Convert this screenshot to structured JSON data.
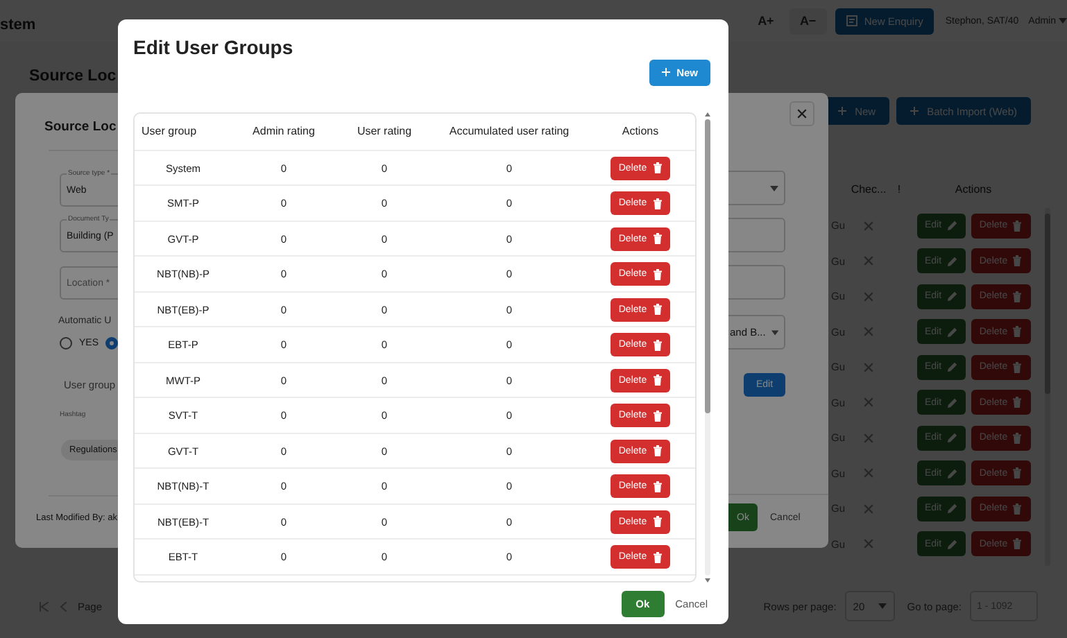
{
  "app_header": {
    "title": "stem",
    "font_increase": "A+",
    "font_decrease": "A−",
    "new_enquiry": "New Enquiry",
    "user": "Stephon, SAT/40",
    "role": "Admin"
  },
  "page": {
    "title": "Source Loc",
    "buttons": [
      "New",
      "Batch Import (Web)"
    ],
    "table": {
      "columns": [
        "Chec...",
        "!",
        "Actions"
      ],
      "rows": [
        {
          "column_1": "Gu",
          "checked": false,
          "edit": "Edit",
          "delete": "Delete"
        },
        {
          "column_1": "Gu",
          "checked": false,
          "edit": "Edit",
          "delete": "Delete"
        },
        {
          "column_1": "Gu",
          "checked": false,
          "edit": "Edit",
          "delete": "Delete"
        },
        {
          "column_1": "Gu",
          "checked": false,
          "edit": "Edit",
          "delete": "Delete"
        },
        {
          "column_1": "Gu",
          "checked": false,
          "edit": "Edit",
          "delete": "Delete"
        },
        {
          "column_1": "Gu",
          "checked": false,
          "edit": "Edit",
          "delete": "Delete"
        },
        {
          "column_1": "Gu",
          "checked": false,
          "edit": "Edit",
          "delete": "Delete"
        },
        {
          "column_1": "Gu",
          "checked": false,
          "edit": "Edit",
          "delete": "Delete"
        },
        {
          "column_1": "Gu",
          "checked": false,
          "edit": "Edit",
          "delete": "Delete"
        },
        {
          "column_1": "Gu",
          "checked": false,
          "edit": "Edit",
          "delete": "Delete"
        }
      ]
    },
    "pagination": {
      "page_label": "Page",
      "rows_per_page_label": "Rows per page:",
      "rows_per_page": "20",
      "go_to_page_label": "Go to page:",
      "go_to_page_placeholder": "1 - 1092"
    }
  },
  "source_dialog": {
    "title": "Source Loc",
    "fields": [
      {
        "label": "Source type *",
        "value": "Web"
      },
      {
        "label": "Document Ty",
        "value": "Building (P"
      },
      {
        "placeholder": "Location *"
      }
    ],
    "automatic_label": "Automatic U",
    "radios": [
      {
        "label": "YES",
        "selected": false
      },
      {
        "selected": true
      }
    ],
    "user_group_label": "User group",
    "hashtag_label": "Hashtag",
    "hashtags": [
      "Regulations"
    ],
    "right_fields": [
      {
        "kind": "select"
      },
      {
        "kind": "text"
      },
      {
        "kind": "text"
      },
      {
        "kind": "select",
        "value": "and B..."
      }
    ],
    "edit_button": "Edit",
    "last_modified": "Last Modified By: ak",
    "ok": "Ok",
    "cancel": "Cancel"
  },
  "groups_dialog": {
    "title": "Edit User Groups",
    "new_button": "New",
    "columns": [
      "User group",
      "Admin rating",
      "User rating",
      "Accumulated user rating",
      "Actions"
    ],
    "rows": [
      {
        "user_group": "System",
        "admin_rating": "0",
        "user_rating": "0",
        "accumulated_user_rating": "0",
        "action": "Delete"
      },
      {
        "user_group": "SMT-P",
        "admin_rating": "0",
        "user_rating": "0",
        "accumulated_user_rating": "0",
        "action": "Delete"
      },
      {
        "user_group": "GVT-P",
        "admin_rating": "0",
        "user_rating": "0",
        "accumulated_user_rating": "0",
        "action": "Delete"
      },
      {
        "user_group": "NBT(NB)-P",
        "admin_rating": "0",
        "user_rating": "0",
        "accumulated_user_rating": "0",
        "action": "Delete"
      },
      {
        "user_group": "NBT(EB)-P",
        "admin_rating": "0",
        "user_rating": "0",
        "accumulated_user_rating": "0",
        "action": "Delete"
      },
      {
        "user_group": "EBT-P",
        "admin_rating": "0",
        "user_rating": "0",
        "accumulated_user_rating": "0",
        "action": "Delete"
      },
      {
        "user_group": "MWT-P",
        "admin_rating": "0",
        "user_rating": "0",
        "accumulated_user_rating": "0",
        "action": "Delete"
      },
      {
        "user_group": "SVT-T",
        "admin_rating": "0",
        "user_rating": "0",
        "accumulated_user_rating": "0",
        "action": "Delete"
      },
      {
        "user_group": "GVT-T",
        "admin_rating": "0",
        "user_rating": "0",
        "accumulated_user_rating": "0",
        "action": "Delete"
      },
      {
        "user_group": "NBT(NB)-T",
        "admin_rating": "0",
        "user_rating": "0",
        "accumulated_user_rating": "0",
        "action": "Delete"
      },
      {
        "user_group": "NBT(EB)-T",
        "admin_rating": "0",
        "user_rating": "0",
        "accumulated_user_rating": "0",
        "action": "Delete"
      },
      {
        "user_group": "EBT-T",
        "admin_rating": "0",
        "user_rating": "0",
        "accumulated_user_rating": "0",
        "action": "Delete"
      }
    ],
    "ok": "Ok",
    "cancel": "Cancel"
  }
}
